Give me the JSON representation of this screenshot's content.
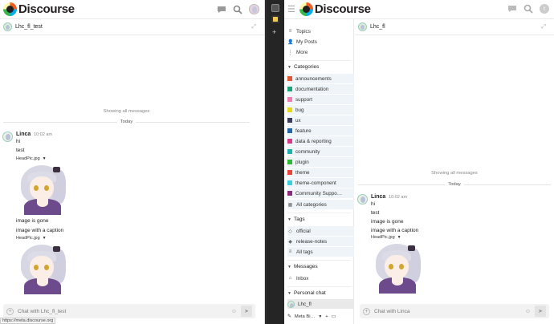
{
  "left": {
    "logo_text": "Discourse",
    "chat_title": "Lhc_fl_test",
    "showing": "Showing all messages",
    "today": "Today",
    "message": {
      "user": "Linca",
      "time": "10:02 am",
      "lines": [
        "hi",
        "test"
      ],
      "file1": "HeadPic.jpg",
      "caption_lines": [
        "image is gone",
        "image with a caption"
      ],
      "file2": "HeadPic.jpg"
    },
    "composer_placeholder": "Chat with Lhc_fl_test",
    "status_url": "https://meta.discourse.org"
  },
  "right": {
    "logo_text": "Discourse",
    "avatar_letter": "t",
    "sidebar": {
      "top": [
        "Topics",
        "My Posts",
        "More"
      ],
      "categories_title": "Categories",
      "categories": [
        {
          "name": "announcements",
          "color": "#e45735"
        },
        {
          "name": "documentation",
          "color": "#1aa37a"
        },
        {
          "name": "support",
          "color": "#ee7cb0"
        },
        {
          "name": "bug",
          "color": "#e7d819"
        },
        {
          "name": "ux",
          "color": "#3c3b5f"
        },
        {
          "name": "feature",
          "color": "#2467a8"
        },
        {
          "name": "data & reporting",
          "color": "#d43c8a"
        },
        {
          "name": "community",
          "color": "#20b2aa"
        },
        {
          "name": "plugin",
          "color": "#2dbb37"
        },
        {
          "name": "theme",
          "color": "#e9453a"
        },
        {
          "name": "theme-component",
          "color": "#3ad0d9"
        },
        {
          "name": "Community Suppo…",
          "color": "#8a2b7c"
        }
      ],
      "all_categories": "All categories",
      "tags_title": "Tags",
      "tags": [
        "official",
        "release-notes"
      ],
      "all_tags": "All tags",
      "messages_title": "Messages",
      "inbox": "Inbox",
      "personal_chat_title": "Personal chat",
      "chat_user": "Lhc_fl",
      "footer_label": "Meta Bi…"
    },
    "chat_title": "Lhc_fl",
    "showing": "Showing all messages",
    "today": "Today",
    "message": {
      "user": "Linca",
      "time": "10:02 am",
      "lines": [
        "hi",
        "test",
        "image is gone",
        "image with a caption"
      ],
      "file": "HeadPic.jpg"
    },
    "composer_placeholder": "Chat with Linca"
  }
}
